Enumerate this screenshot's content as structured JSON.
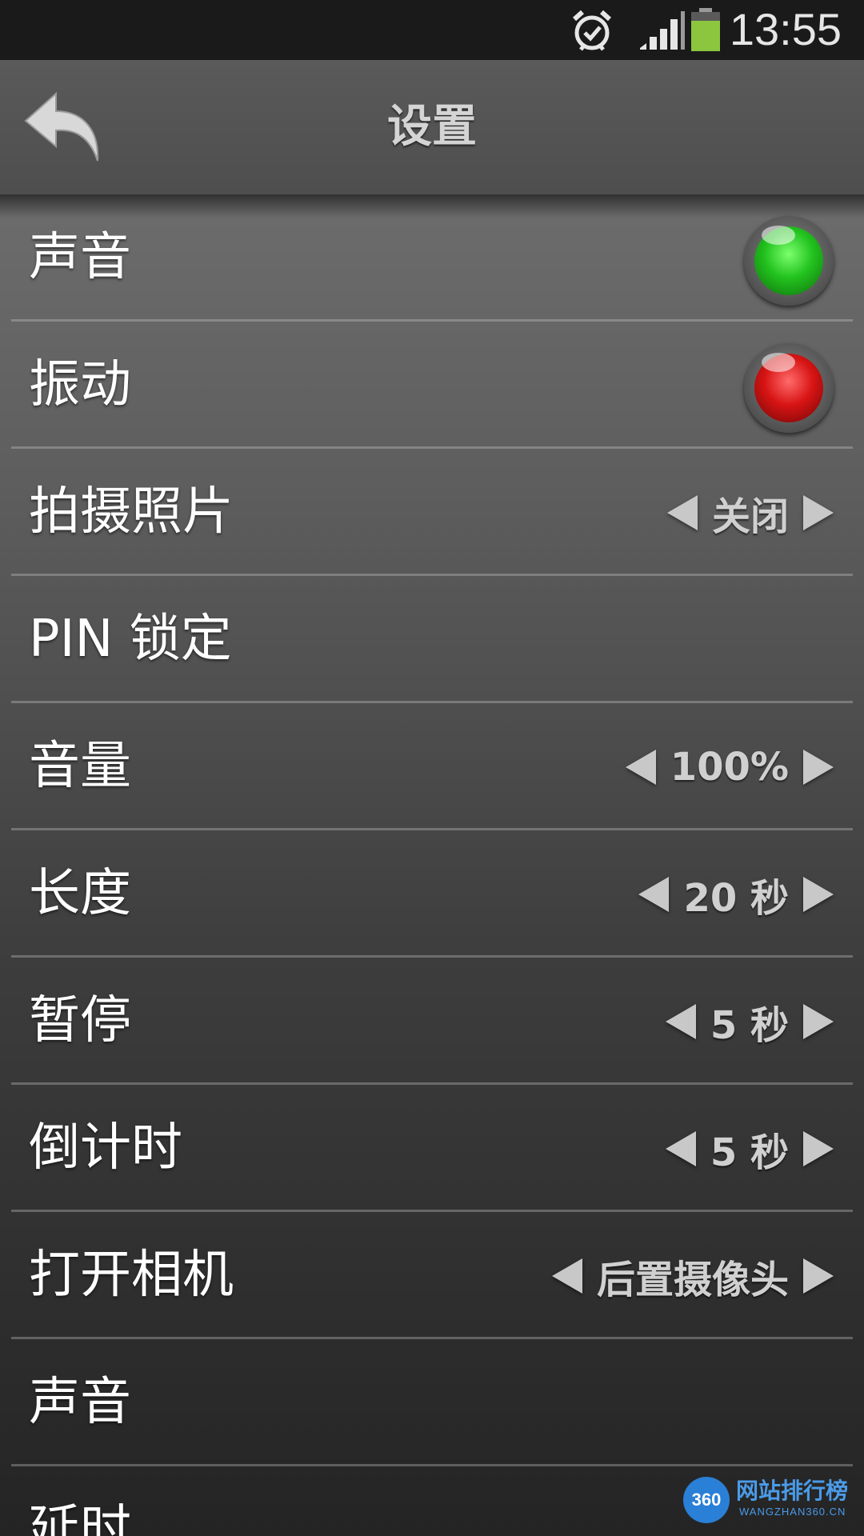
{
  "status_bar": {
    "time": "13:55",
    "icons": [
      "alarm-icon",
      "signal-icon",
      "battery-icon"
    ],
    "battery_color": "#8cc63e"
  },
  "header": {
    "title": "设置",
    "back_icon": "back-arrow-icon"
  },
  "settings": [
    {
      "label": "声音",
      "control": "toggle",
      "state": "on",
      "color": "#22c21e"
    },
    {
      "label": "振动",
      "control": "toggle",
      "state": "off",
      "color": "#d81414"
    },
    {
      "label": "拍摄照片",
      "control": "stepper",
      "value": "关闭"
    },
    {
      "label": "PIN 锁定",
      "control": "none"
    },
    {
      "label": "音量",
      "control": "stepper",
      "value": "100%"
    },
    {
      "label": "长度",
      "control": "stepper",
      "value": "20 秒"
    },
    {
      "label": "暂停",
      "control": "stepper",
      "value": "5 秒"
    },
    {
      "label": "倒计时",
      "control": "stepper",
      "value": "5 秒"
    },
    {
      "label": "打开相机",
      "control": "stepper",
      "value": "后置摄像头"
    },
    {
      "label": "声音",
      "control": "none"
    },
    {
      "label": "延时",
      "control": "none"
    }
  ],
  "watermark": {
    "badge": "360",
    "text": "网站排行榜",
    "sub": "WANGZHAN360.CN"
  }
}
